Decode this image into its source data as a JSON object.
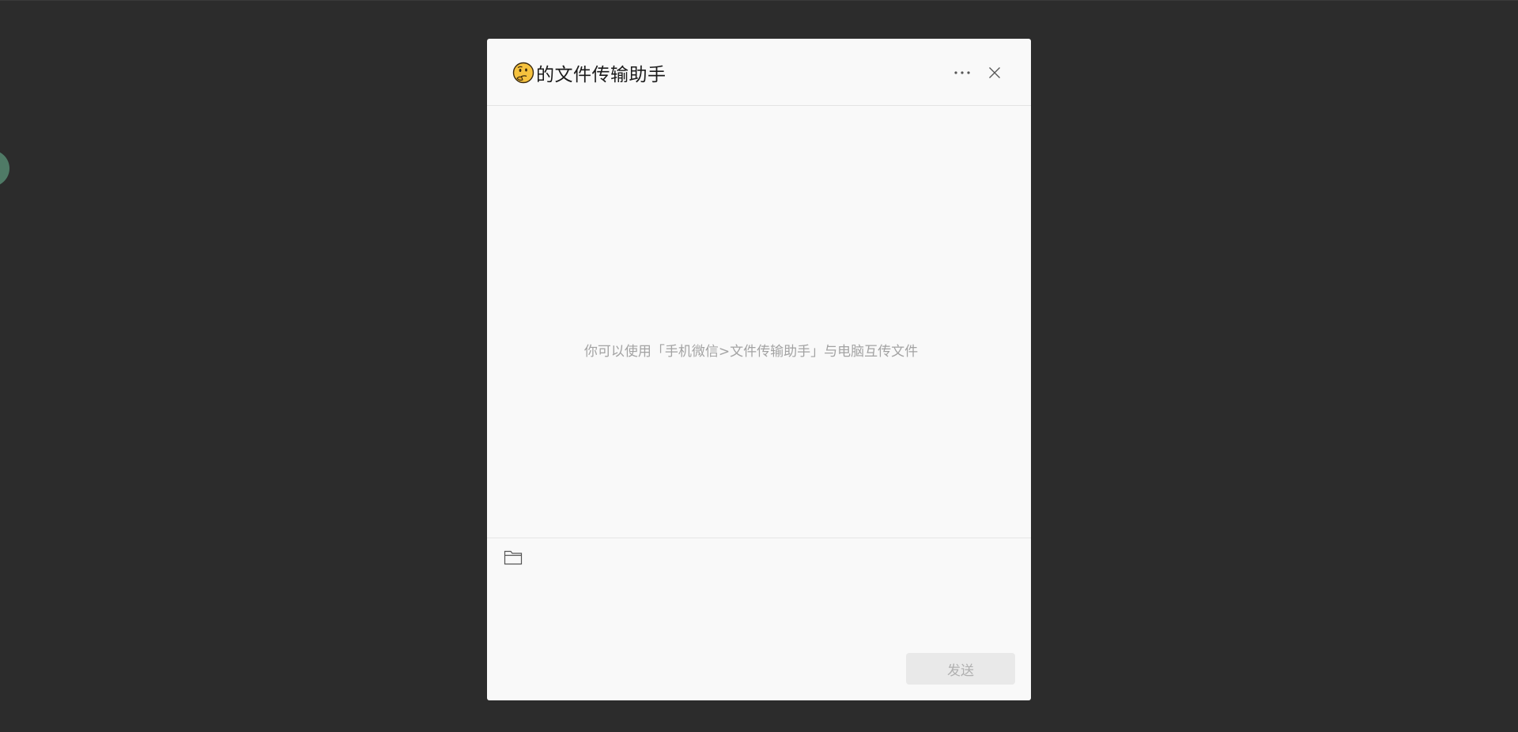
{
  "dialog": {
    "avatar_icon": "thinking-face-emoji",
    "title": "的文件传输助手",
    "more_icon": "more-horizontal-icon",
    "close_icon": "close-icon"
  },
  "chat": {
    "hint": "你可以使用「手机微信>文件传输助手」与电脑互传文件"
  },
  "composer": {
    "folder_icon": "folder-icon",
    "input_value": "",
    "send_label": "发送"
  },
  "colors": {
    "background": "#2c2c2c",
    "dialog_bg": "#f9f9f9",
    "hint_text": "#a3a3a3",
    "send_button_bg": "#e9e9e9",
    "side_avatar": "#4f7a66"
  }
}
